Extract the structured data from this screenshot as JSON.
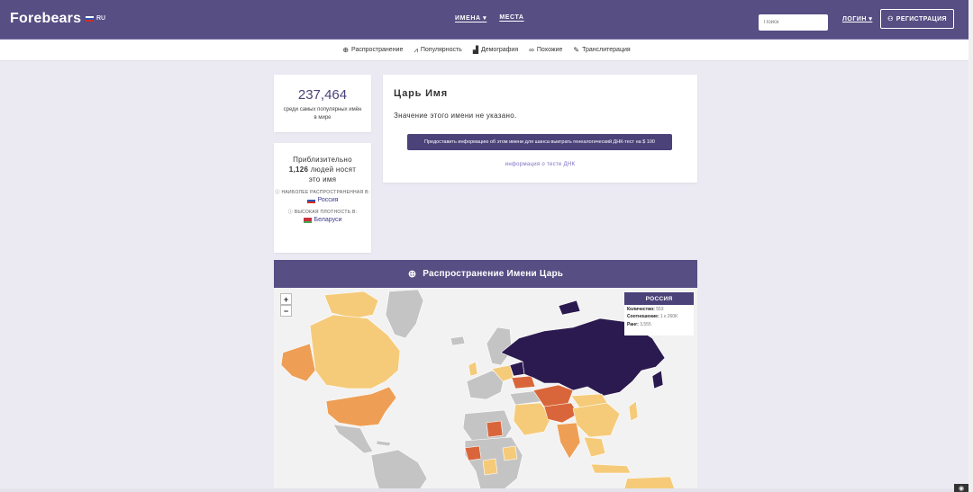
{
  "header": {
    "logo": "Forebears",
    "lang": "RU",
    "nav": [
      "ИМЕНА ▾",
      "МЕСТА"
    ],
    "search_placeholder": "Поиск",
    "login": "ЛОГИН ▾",
    "register": "РЕГИСТРАЦИЯ"
  },
  "subnav": [
    {
      "icon": "globe-icon",
      "glyph": "⊕",
      "label": "Распространение"
    },
    {
      "icon": "chart-line-icon",
      "glyph": "📈",
      "label": "Популярность"
    },
    {
      "icon": "bar-chart-icon",
      "glyph": "▟",
      "label": "Демография"
    },
    {
      "icon": "link-icon",
      "glyph": "🔗",
      "label": "Похожие"
    },
    {
      "icon": "transliteration-icon",
      "glyph": "✎",
      "label": "Транслитерация"
    }
  ],
  "rank": {
    "number": "237,464",
    "text": "среди самых популярных имён в мире"
  },
  "people": {
    "text_before": "Приблизительно",
    "count": "1,126",
    "text_after": "людей носят это имя",
    "most_common_label": "НАИБОЛЕЕ РАСПРОСТРАНЕННАЯ В:",
    "most_common_country": "Россия",
    "highest_density_label": "ВЫСОКАЯ ПЛОТНОСТЬ В:",
    "highest_density_country": "Беларуси"
  },
  "main": {
    "title": "Царь Имя",
    "description": "Значение этого имени не указано.",
    "dna_button": "Предоставить информацию об этом имени для шанса выиграть генеалогический ДНК-тест на $ 100",
    "dna_link": "информация о тесте ДНК"
  },
  "map": {
    "title": "Распространение Имени Царь",
    "zoom_in": "+",
    "zoom_out": "−",
    "info": {
      "country": "РОССИЯ",
      "count_label": "Количество:",
      "count_value": "553",
      "ratio_label": "Соотношение:",
      "ratio_value": "1 к 260K",
      "rank_label": "Ранг:",
      "rank_value": "3,555"
    },
    "colors": {
      "highest": "#2b1a4f",
      "high": "#d9663a",
      "medium": "#ee9f55",
      "low": "#f5cb7a",
      "none": "#c4c4c4"
    }
  }
}
